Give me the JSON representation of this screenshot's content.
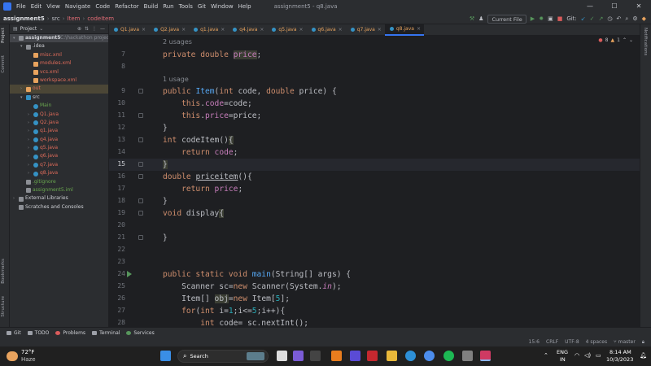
{
  "menubar": {
    "items": [
      "File",
      "Edit",
      "View",
      "Navigate",
      "Code",
      "Refactor",
      "Build",
      "Run",
      "Tools",
      "Git",
      "Window",
      "Help"
    ],
    "window_title": "assignment5 - q8.java",
    "controls": [
      "—",
      "☐",
      "✕"
    ]
  },
  "navbar": {
    "crumbs": [
      "assignment5",
      "src",
      "Item",
      "codeItem"
    ],
    "run_config": "Current File",
    "git_label": "Git:"
  },
  "project": {
    "header": "Project",
    "tree": [
      {
        "label": "assignment5",
        "extra": "C:\\hackathon project",
        "level": 0,
        "arrow": "▾",
        "icon": "folder"
      },
      {
        "label": ".idea",
        "level": 1,
        "arrow": "▾",
        "icon": "folder"
      },
      {
        "label": "misc.xml",
        "level": 2,
        "icon": "xml"
      },
      {
        "label": "modules.xml",
        "level": 2,
        "icon": "xml"
      },
      {
        "label": "vcs.xml",
        "level": 2,
        "icon": "xml"
      },
      {
        "label": "workspace.xml",
        "level": 2,
        "icon": "xml"
      },
      {
        "label": "out",
        "level": 1,
        "arrow": "›",
        "icon": "folder-out"
      },
      {
        "label": "src",
        "level": 1,
        "arrow": "▾",
        "icon": "folder-src"
      },
      {
        "label": "Main",
        "level": 2,
        "icon": "class"
      },
      {
        "label": "Q1.java",
        "level": 2,
        "arrow": "›",
        "icon": "java"
      },
      {
        "label": "Q2.java",
        "level": 2,
        "arrow": "›",
        "icon": "java"
      },
      {
        "label": "q1.java",
        "level": 2,
        "arrow": "›",
        "icon": "java"
      },
      {
        "label": "q4.java",
        "level": 2,
        "arrow": "›",
        "icon": "java"
      },
      {
        "label": "q5.java",
        "level": 2,
        "arrow": "›",
        "icon": "java"
      },
      {
        "label": "q6.java",
        "level": 2,
        "arrow": "›",
        "icon": "java"
      },
      {
        "label": "q7.java",
        "level": 2,
        "arrow": "›",
        "icon": "java"
      },
      {
        "label": "q8.java",
        "level": 2,
        "arrow": "›",
        "icon": "java"
      },
      {
        "label": ".gitignore",
        "level": 1,
        "icon": "file"
      },
      {
        "label": "assignment5.iml",
        "level": 1,
        "icon": "iml"
      },
      {
        "label": "External Libraries",
        "level": 0,
        "arrow": "›",
        "icon": "lib"
      },
      {
        "label": "Scratches and Consoles",
        "level": 0,
        "icon": "scratch"
      }
    ]
  },
  "left_tools": [
    "Project",
    "Commit",
    "Bookmarks",
    "Structure"
  ],
  "right_tools": [
    "Notifications"
  ],
  "tabs": [
    "Q1.java",
    "Q2.java",
    "q1.java",
    "q4.java",
    "q5.java",
    "q6.java",
    "q7.java",
    "q8.java"
  ],
  "active_tab": "q8.java",
  "inspections": {
    "errors": "8",
    "warnings": "1"
  },
  "editor": {
    "hints": {
      "usages_price": "2 usages",
      "usages_item": "1 usage"
    },
    "line_numbers": [
      "7",
      "8",
      "9",
      "10",
      "11",
      "12",
      "13",
      "14",
      "15",
      "16",
      "17",
      "18",
      "19",
      "20",
      "21",
      "22",
      "23",
      "24",
      "25",
      "26",
      "27",
      "28"
    ],
    "current_line": "15"
  },
  "bottom_tools": [
    "Git",
    "TODO",
    "Problems",
    "Terminal",
    "Services"
  ],
  "status": {
    "position": "15:6",
    "line_sep": "CRLF",
    "encoding": "UTF-8",
    "indent": "4 spaces",
    "branch": "master"
  },
  "taskbar": {
    "weather_temp": "72°F",
    "weather_desc": "Haze",
    "search_placeholder": "Search",
    "lang": "ENG",
    "region": "IN",
    "time": "8:14 AM",
    "date": "10/3/2023"
  },
  "colors": {
    "accent": "#3574f0",
    "keyword": "#cf8e6d",
    "field": "#c77dbb",
    "method": "#56a8f5",
    "number": "#2aacb8"
  }
}
